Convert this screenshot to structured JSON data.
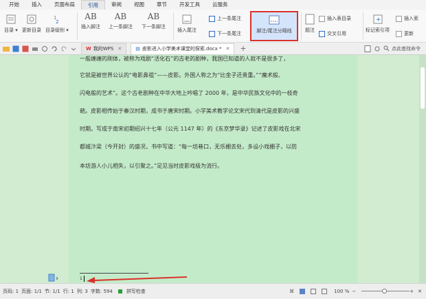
{
  "menu": {
    "items": [
      "开始",
      "插入",
      "页面布局",
      "引用",
      "审阅",
      "视图",
      "章节",
      "开发工具",
      "云服务"
    ]
  },
  "ribbon": {
    "toc": "目录",
    "update_toc": "更新目录",
    "toc_level": "目录级别",
    "insert_footnote": "插入脚注",
    "prev_footnote": "上一条脚注",
    "next_footnote": "下一条脚注",
    "insert_endnote": "插入尾注",
    "prev_endnote": "上一条尾注",
    "next_endnote": "下一条尾注",
    "separator": "脚注/尾注分隔线",
    "insert_caption_dir": "插入表目录",
    "caption": "题注",
    "cross_ref": "交叉引用",
    "mark_index": "标记索引项",
    "insert_index": "插入索",
    "update_index": "更新"
  },
  "toolbar": {
    "tab1": "我的WPS",
    "tab2": "皮影进入小学美术课堂的探索.docx *",
    "new_tab": "+",
    "search_placeholder": "点此查找命令"
  },
  "document": {
    "lines": [
      "一般缠缠的刚体，被称为戏剧“活化石”的古老的剧种，我国已知道的人就不是很多了，",
      "它就是被世界公认的“电影鼻祖”——皮影。外国人称之为“比金子还贵重。”“魔术般、",
      "闪电般的艺术”。这个古老剧种在中华大地上吟唱了 2000 年，是中华民族文化中的一枝奇",
      "葩。皮影相传始于秦汉时期，成书于唐宋时期。小学美术教学论文宋代到清代是皮影的兴盛",
      "时期。写成于南宋初期绍兴十七年（公元 1147 年）的《东京梦华录》记述了皮影戏在北宋",
      "都城汴梁（今开封）的盛况，书中写道：“每一坊巷口，无乐棚去处，多设小戏棚子，以防",
      "本坊游人小儿相失，以引聚之。”足见当时皮影戏极为流行。"
    ],
    "footnote_number": "1"
  },
  "status": {
    "page": "页码: 1",
    "pages": "页面: 1/1",
    "section": "节: 1/1",
    "row": "行: 1",
    "col": "列: 3",
    "words": "字数: 594",
    "spell": "拼写检查",
    "zoom": "100 %"
  },
  "colors": {
    "accent": "#d9312b",
    "page": "#c4ebc9",
    "highlight": "#d4e4fb"
  }
}
